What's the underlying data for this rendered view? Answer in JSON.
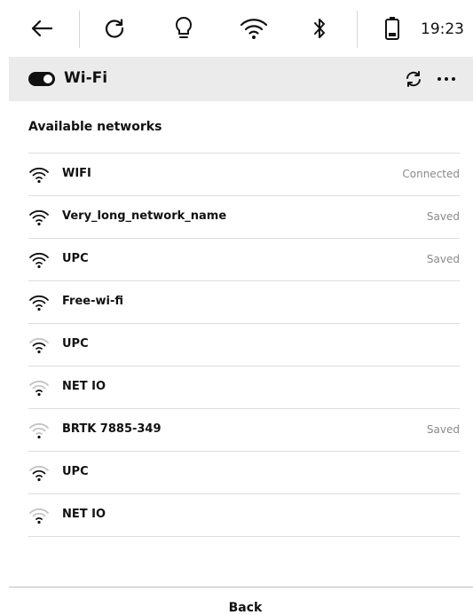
{
  "status_bar": {
    "icons": [
      "back-arrow-icon",
      "refresh-icon",
      "lightbulb-icon",
      "wifi-icon",
      "bluetooth-icon",
      "battery-icon"
    ],
    "time": "19:23"
  },
  "header": {
    "title": "Wi-Fi",
    "toggle_on": true,
    "actions": [
      "refresh-icon",
      "more-icon"
    ]
  },
  "section_title": "Available networks",
  "networks": [
    {
      "name": "WIFI",
      "status": "Connected",
      "signal": 4
    },
    {
      "name": "Very_long_network_name",
      "status": "Saved",
      "signal": 4
    },
    {
      "name": "UPC",
      "status": "Saved",
      "signal": 4
    },
    {
      "name": "Free-wi-fi",
      "status": "",
      "signal": 4
    },
    {
      "name": "UPC",
      "status": "",
      "signal": 3
    },
    {
      "name": "NET IO",
      "status": "",
      "signal": 2
    },
    {
      "name": "BRTK 7885-349",
      "status": "Saved",
      "signal": 1
    },
    {
      "name": "UPC",
      "status": "",
      "signal": 3
    },
    {
      "name": "NET IO",
      "status": "",
      "signal": 2
    }
  ],
  "footer": {
    "back_label": "Back"
  }
}
